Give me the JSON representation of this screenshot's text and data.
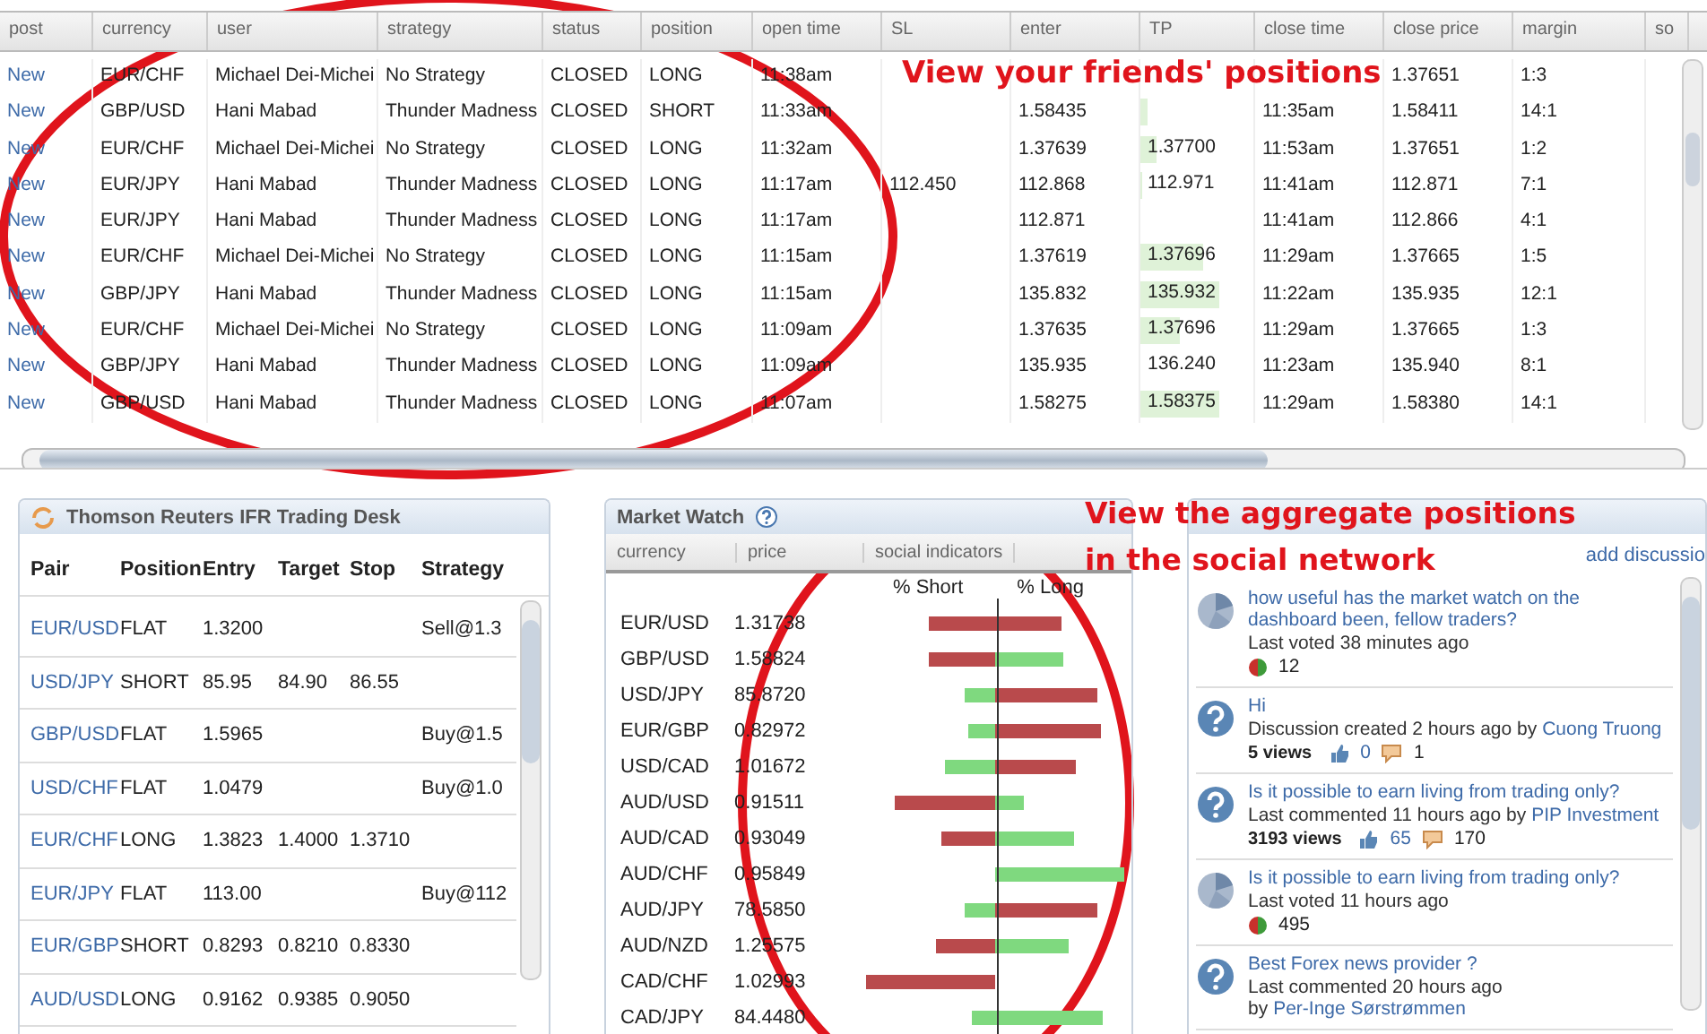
{
  "positions_table": {
    "columns": [
      "post",
      "currency",
      "user",
      "strategy",
      "status",
      "position",
      "open time",
      "SL",
      "enter",
      "TP",
      "close time",
      "close price",
      "margin",
      "so"
    ],
    "rows": [
      {
        "post": "New",
        "currency": "EUR/CHF",
        "user": "Michael Dei-Michei",
        "strategy": "No Strategy",
        "status": "CLOSED",
        "position": "LONG",
        "open_time": "11:38am",
        "close_price": "1.37651",
        "margin": "1:3"
      },
      {
        "post": "New",
        "currency": "GBP/USD",
        "user": "Hani Mabad",
        "strategy": "Thunder Madness",
        "status": "CLOSED",
        "position": "SHORT",
        "open_time": "11:33am",
        "enter": "1.58435",
        "tp": {
          "level": 0.06
        },
        "close_time": "11:35am",
        "close_price": "1.58411",
        "margin": "14:1"
      },
      {
        "post": "New",
        "currency": "EUR/CHF",
        "user": "Michael Dei-Michei",
        "strategy": "No Strategy",
        "status": "CLOSED",
        "position": "LONG",
        "open_time": "11:32am",
        "enter": "1.37639",
        "tp": {
          "text": "1.37700",
          "level": 0.15
        },
        "close_time": "11:53am",
        "close_price": "1.37651",
        "margin": "1:2"
      },
      {
        "post": "New",
        "currency": "EUR/JPY",
        "user": "Hani Mabad",
        "strategy": "Thunder Madness",
        "status": "CLOSED",
        "position": "LONG",
        "open_time": "11:17am",
        "sl": "112.450",
        "enter": "112.868",
        "tp": {
          "text": "112.971",
          "level": 0.02
        },
        "close_time": "11:41am",
        "close_price": "112.871",
        "margin": "7:1"
      },
      {
        "post": "New",
        "currency": "EUR/JPY",
        "user": "Hani Mabad",
        "strategy": "Thunder Madness",
        "status": "CLOSED",
        "position": "LONG",
        "open_time": "11:17am",
        "enter": "112.871",
        "close_time": "11:41am",
        "close_price": "112.866",
        "margin": "4:1"
      },
      {
        "post": "New",
        "currency": "EUR/CHF",
        "user": "Michael Dei-Michei",
        "strategy": "No Strategy",
        "status": "CLOSED",
        "position": "LONG",
        "open_time": "11:15am",
        "enter": "1.37619",
        "tp": {
          "text": "1.37696",
          "level": 0.55
        },
        "close_time": "11:29am",
        "close_price": "1.37665",
        "margin": "1:5"
      },
      {
        "post": "New",
        "currency": "GBP/JPY",
        "user": "Hani Mabad",
        "strategy": "Thunder Madness",
        "status": "CLOSED",
        "position": "LONG",
        "open_time": "11:15am",
        "enter": "135.832",
        "tp": {
          "text": "135.932",
          "level": 0.7
        },
        "close_time": "11:22am",
        "close_price": "135.935",
        "margin": "12:1"
      },
      {
        "post": "New",
        "currency": "EUR/CHF",
        "user": "Michael Dei-Michei",
        "strategy": "No Strategy",
        "status": "CLOSED",
        "position": "LONG",
        "open_time": "11:09am",
        "enter": "1.37635",
        "tp": {
          "text": "1.37696",
          "level": 0.35
        },
        "close_time": "11:29am",
        "close_price": "1.37665",
        "margin": "1:3"
      },
      {
        "post": "New",
        "currency": "GBP/JPY",
        "user": "Hani Mabad",
        "strategy": "Thunder Madness",
        "status": "CLOSED",
        "position": "LONG",
        "open_time": "11:09am",
        "enter": "135.935",
        "tp": {
          "text": "136.240"
        },
        "close_time": "11:23am",
        "close_price": "135.940",
        "margin": "8:1"
      },
      {
        "post": "New",
        "currency": "GBP/USD",
        "user": "Hani Mabad",
        "strategy": "Thunder Madness",
        "status": "CLOSED",
        "position": "LONG",
        "open_time": "11:07am",
        "enter": "1.58275",
        "tp": {
          "text": "1.58375",
          "level": 0.7
        },
        "close_time": "11:29am",
        "close_price": "1.58380",
        "margin": "14:1"
      }
    ]
  },
  "trading_desk": {
    "title": "Thomson Reuters IFR Trading Desk",
    "columns": [
      "Pair",
      "Position",
      "Entry",
      "Target",
      "Stop",
      "Strategy"
    ],
    "rows": [
      [
        "EUR/USD",
        "FLAT",
        "1.3200",
        "",
        "",
        "Sell@1.3"
      ],
      [
        "USD/JPY",
        "SHORT",
        "85.95",
        "84.90",
        "86.55",
        ""
      ],
      [
        "GBP/USD",
        "FLAT",
        "1.5965",
        "",
        "",
        "Buy@1.5"
      ],
      [
        "USD/CHF",
        "FLAT",
        "1.0479",
        "",
        "",
        "Buy@1.0"
      ],
      [
        "EUR/CHF",
        "LONG",
        "1.3823",
        "1.4000",
        "1.3710",
        ""
      ],
      [
        "EUR/JPY",
        "FLAT",
        "113.00",
        "",
        "",
        "Buy@112"
      ],
      [
        "EUR/GBP",
        "SHORT",
        "0.8293",
        "0.8210",
        "0.8330",
        ""
      ],
      [
        "AUD/USD",
        "LONG",
        "0.9162",
        "0.9385",
        "0.9050",
        ""
      ]
    ]
  },
  "market_watch": {
    "title": "Market Watch",
    "columns": [
      "currency",
      "price",
      "social indicators"
    ],
    "short_label": "% Short",
    "long_label": "% Long",
    "rows": [
      {
        "currency": "EUR/USD",
        "price": "1.31738",
        "short": {
          "color": "#b94a4c"
        },
        "long": {
          "color": "#b94a4c"
        }
      },
      {
        "currency": "GBP/USD",
        "price": "1.58824",
        "short": {
          "color": "#b94a4c"
        },
        "long": {
          "color": "#7fd97f"
        }
      },
      {
        "currency": "USD/JPY",
        "price": "85.8720",
        "short": {
          "color": "#7fd97f"
        },
        "long": {
          "color": "#b94a4c"
        }
      },
      {
        "currency": "EUR/GBP",
        "price": "0.82972",
        "short": {
          "color": "#7fd97f"
        },
        "long": {
          "color": "#b94a4c"
        }
      },
      {
        "currency": "USD/CAD",
        "price": "1.01672",
        "short": {
          "color": "#7fd97f"
        },
        "long": {
          "color": "#b94a4c"
        }
      },
      {
        "currency": "AUD/USD",
        "price": "0.91511",
        "short": {
          "color": "#b94a4c"
        },
        "long": {
          "color": "#7fd97f"
        }
      },
      {
        "currency": "AUD/CAD",
        "price": "0.93049",
        "short": {
          "color": "#b94a4c"
        },
        "long": {
          "color": "#7fd97f"
        }
      },
      {
        "currency": "AUD/CHF",
        "price": "0.95849",
        "long": {
          "color": "#7fd97f"
        }
      },
      {
        "currency": "AUD/JPY",
        "price": "78.5850",
        "short": {
          "color": "#7fd97f"
        },
        "long": {
          "color": "#b94a4c"
        }
      },
      {
        "currency": "AUD/NZD",
        "price": "1.25575",
        "short": {
          "color": "#b94a4c"
        },
        "long": {
          "color": "#7fd97f"
        }
      },
      {
        "currency": "CAD/CHF",
        "price": "1.02993",
        "short": {
          "color": "#b94a4c"
        }
      },
      {
        "currency": "CAD/JPY",
        "price": "84.4480",
        "short": {
          "color": "#7fd97f"
        },
        "long": {
          "color": "#7fd97f"
        }
      }
    ]
  },
  "discussions": {
    "add_link": "add discussio",
    "items": [
      {
        "kind": "poll",
        "title": "how useful has the market watch on the dashboard been, fellow traders?",
        "meta": "Last voted 38 minutes ago",
        "votes": "12"
      },
      {
        "kind": "question",
        "title": "Hi",
        "meta": "Discussion created 2 hours ago by",
        "author": "Cuong Truong",
        "views": "5 views",
        "likes": "0",
        "comments": "1"
      },
      {
        "kind": "question",
        "title": "Is it possible to earn living from trading only?",
        "meta": "Last commented 11 hours ago by",
        "author": "PIP Investment",
        "views": "3193 views",
        "likes": "65",
        "comments": "170"
      },
      {
        "kind": "poll",
        "title": "Is it possible to earn living from trading only?",
        "meta": "Last voted 11 hours ago",
        "votes": "495"
      },
      {
        "kind": "question",
        "title": "Best Forex news provider ?",
        "meta": "Last commented 20 hours ago by",
        "author": "Per-Inge Sørstrømmen"
      }
    ]
  },
  "annotations": [
    "View your friends' positions",
    "View the aggregate positions in the social network"
  ]
}
